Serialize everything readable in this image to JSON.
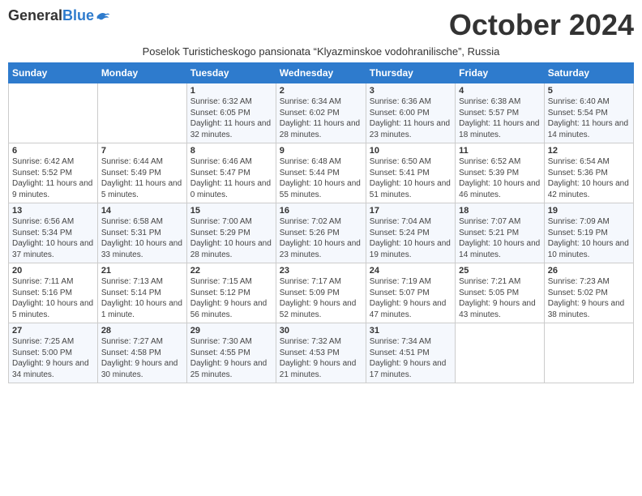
{
  "header": {
    "logo_general": "General",
    "logo_blue": "Blue",
    "month_title": "October 2024",
    "subtitle": "Poselok Turisticheskogo pansionata “Klyazminskoe vodohranilische”, Russia"
  },
  "weekdays": [
    "Sunday",
    "Monday",
    "Tuesday",
    "Wednesday",
    "Thursday",
    "Friday",
    "Saturday"
  ],
  "weeks": [
    [
      {
        "day": "",
        "info": ""
      },
      {
        "day": "",
        "info": ""
      },
      {
        "day": "1",
        "info": "Sunrise: 6:32 AM\nSunset: 6:05 PM\nDaylight: 11 hours and 32 minutes."
      },
      {
        "day": "2",
        "info": "Sunrise: 6:34 AM\nSunset: 6:02 PM\nDaylight: 11 hours and 28 minutes."
      },
      {
        "day": "3",
        "info": "Sunrise: 6:36 AM\nSunset: 6:00 PM\nDaylight: 11 hours and 23 minutes."
      },
      {
        "day": "4",
        "info": "Sunrise: 6:38 AM\nSunset: 5:57 PM\nDaylight: 11 hours and 18 minutes."
      },
      {
        "day": "5",
        "info": "Sunrise: 6:40 AM\nSunset: 5:54 PM\nDaylight: 11 hours and 14 minutes."
      }
    ],
    [
      {
        "day": "6",
        "info": "Sunrise: 6:42 AM\nSunset: 5:52 PM\nDaylight: 11 hours and 9 minutes."
      },
      {
        "day": "7",
        "info": "Sunrise: 6:44 AM\nSunset: 5:49 PM\nDaylight: 11 hours and 5 minutes."
      },
      {
        "day": "8",
        "info": "Sunrise: 6:46 AM\nSunset: 5:47 PM\nDaylight: 11 hours and 0 minutes."
      },
      {
        "day": "9",
        "info": "Sunrise: 6:48 AM\nSunset: 5:44 PM\nDaylight: 10 hours and 55 minutes."
      },
      {
        "day": "10",
        "info": "Sunrise: 6:50 AM\nSunset: 5:41 PM\nDaylight: 10 hours and 51 minutes."
      },
      {
        "day": "11",
        "info": "Sunrise: 6:52 AM\nSunset: 5:39 PM\nDaylight: 10 hours and 46 minutes."
      },
      {
        "day": "12",
        "info": "Sunrise: 6:54 AM\nSunset: 5:36 PM\nDaylight: 10 hours and 42 minutes."
      }
    ],
    [
      {
        "day": "13",
        "info": "Sunrise: 6:56 AM\nSunset: 5:34 PM\nDaylight: 10 hours and 37 minutes."
      },
      {
        "day": "14",
        "info": "Sunrise: 6:58 AM\nSunset: 5:31 PM\nDaylight: 10 hours and 33 minutes."
      },
      {
        "day": "15",
        "info": "Sunrise: 7:00 AM\nSunset: 5:29 PM\nDaylight: 10 hours and 28 minutes."
      },
      {
        "day": "16",
        "info": "Sunrise: 7:02 AM\nSunset: 5:26 PM\nDaylight: 10 hours and 23 minutes."
      },
      {
        "day": "17",
        "info": "Sunrise: 7:04 AM\nSunset: 5:24 PM\nDaylight: 10 hours and 19 minutes."
      },
      {
        "day": "18",
        "info": "Sunrise: 7:07 AM\nSunset: 5:21 PM\nDaylight: 10 hours and 14 minutes."
      },
      {
        "day": "19",
        "info": "Sunrise: 7:09 AM\nSunset: 5:19 PM\nDaylight: 10 hours and 10 minutes."
      }
    ],
    [
      {
        "day": "20",
        "info": "Sunrise: 7:11 AM\nSunset: 5:16 PM\nDaylight: 10 hours and 5 minutes."
      },
      {
        "day": "21",
        "info": "Sunrise: 7:13 AM\nSunset: 5:14 PM\nDaylight: 10 hours and 1 minute."
      },
      {
        "day": "22",
        "info": "Sunrise: 7:15 AM\nSunset: 5:12 PM\nDaylight: 9 hours and 56 minutes."
      },
      {
        "day": "23",
        "info": "Sunrise: 7:17 AM\nSunset: 5:09 PM\nDaylight: 9 hours and 52 minutes."
      },
      {
        "day": "24",
        "info": "Sunrise: 7:19 AM\nSunset: 5:07 PM\nDaylight: 9 hours and 47 minutes."
      },
      {
        "day": "25",
        "info": "Sunrise: 7:21 AM\nSunset: 5:05 PM\nDaylight: 9 hours and 43 minutes."
      },
      {
        "day": "26",
        "info": "Sunrise: 7:23 AM\nSunset: 5:02 PM\nDaylight: 9 hours and 38 minutes."
      }
    ],
    [
      {
        "day": "27",
        "info": "Sunrise: 7:25 AM\nSunset: 5:00 PM\nDaylight: 9 hours and 34 minutes."
      },
      {
        "day": "28",
        "info": "Sunrise: 7:27 AM\nSunset: 4:58 PM\nDaylight: 9 hours and 30 minutes."
      },
      {
        "day": "29",
        "info": "Sunrise: 7:30 AM\nSunset: 4:55 PM\nDaylight: 9 hours and 25 minutes."
      },
      {
        "day": "30",
        "info": "Sunrise: 7:32 AM\nSunset: 4:53 PM\nDaylight: 9 hours and 21 minutes."
      },
      {
        "day": "31",
        "info": "Sunrise: 7:34 AM\nSunset: 4:51 PM\nDaylight: 9 hours and 17 minutes."
      },
      {
        "day": "",
        "info": ""
      },
      {
        "day": "",
        "info": ""
      }
    ]
  ]
}
